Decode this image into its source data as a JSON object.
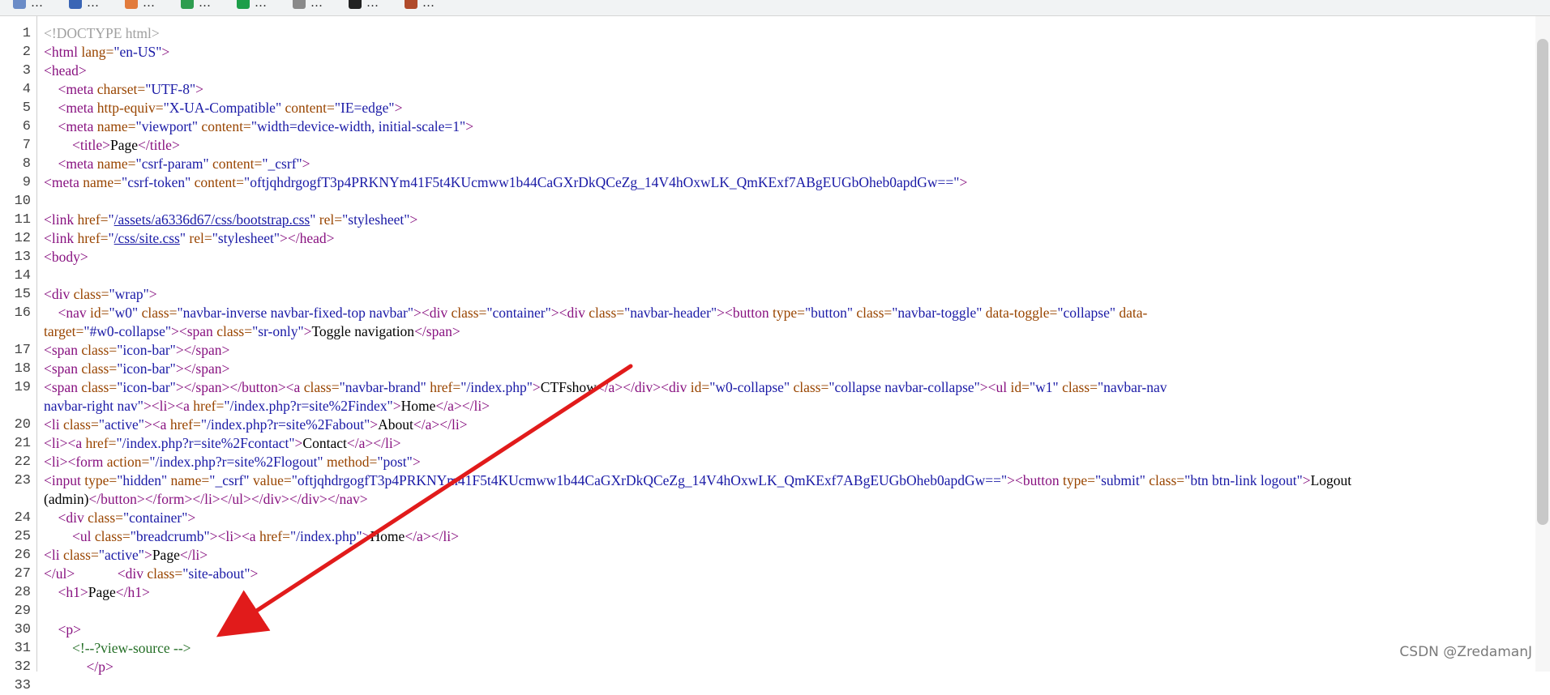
{
  "bookmarks": [
    {
      "label": "…"
    },
    {
      "label": "…"
    },
    {
      "label": "…"
    },
    {
      "label": "…"
    },
    {
      "label": "…"
    },
    {
      "label": "…"
    },
    {
      "label": "…"
    },
    {
      "label": "…"
    }
  ],
  "source": {
    "lines": [
      {
        "n": "1",
        "html": "<span class=\"d\">&lt;!DOCTYPE html&gt;</span>"
      },
      {
        "n": "2",
        "html": "<span class=\"t\">&lt;html</span> <span class=\"a\">lang=</span><span class=\"v\">\"en-US\"</span><span class=\"t\">&gt;</span>"
      },
      {
        "n": "3",
        "html": "<span class=\"t\">&lt;head&gt;</span>"
      },
      {
        "n": "4",
        "html": "    <span class=\"t\">&lt;meta</span> <span class=\"a\">charset=</span><span class=\"v\">\"UTF-8\"</span><span class=\"t\">&gt;</span>"
      },
      {
        "n": "5",
        "html": "    <span class=\"t\">&lt;meta</span> <span class=\"a\">http-equiv=</span><span class=\"v\">\"X-UA-Compatible\"</span> <span class=\"a\">content=</span><span class=\"v\">\"IE=edge\"</span><span class=\"t\">&gt;</span>"
      },
      {
        "n": "6",
        "html": "    <span class=\"t\">&lt;meta</span> <span class=\"a\">name=</span><span class=\"v\">\"viewport\"</span> <span class=\"a\">content=</span><span class=\"v\">\"width=device-width, initial-scale=1\"</span><span class=\"t\">&gt;</span>"
      },
      {
        "n": "7",
        "html": "        <span class=\"t\">&lt;title&gt;</span><span class=\"txt\">Page</span><span class=\"t\">&lt;/title&gt;</span>"
      },
      {
        "n": "8",
        "html": "    <span class=\"t\">&lt;meta</span> <span class=\"a\">name=</span><span class=\"v\">\"csrf-param\"</span> <span class=\"a\">content=</span><span class=\"v\">\"_csrf\"</span><span class=\"t\">&gt;</span>"
      },
      {
        "n": "9",
        "html": "<span class=\"t\">&lt;meta</span> <span class=\"a\">name=</span><span class=\"v\">\"csrf-token\"</span> <span class=\"a\">content=</span><span class=\"v\">\"oftjqhdrgogfT3p4PRKNYm41F5t4KUcmww1b44CaGXrDkQCeZg_14V4hOxwLK_QmKExf7ABgEUGbOheb0apdGw==\"</span><span class=\"t\">&gt;</span>"
      },
      {
        "n": "10",
        "html": ""
      },
      {
        "n": "11",
        "html": "<span class=\"t\">&lt;link</span> <span class=\"a\">href=</span><span class=\"v\">\"</span><span class=\"link\">/assets/a6336d67/css/bootstrap.css</span><span class=\"v\">\"</span> <span class=\"a\">rel=</span><span class=\"v\">\"stylesheet\"</span><span class=\"t\">&gt;</span>"
      },
      {
        "n": "12",
        "html": "<span class=\"t\">&lt;link</span> <span class=\"a\">href=</span><span class=\"v\">\"</span><span class=\"link\">/css/site.css</span><span class=\"v\">\"</span> <span class=\"a\">rel=</span><span class=\"v\">\"stylesheet\"</span><span class=\"t\">&gt;&lt;/head&gt;</span>"
      },
      {
        "n": "13",
        "html": "<span class=\"t\">&lt;body&gt;</span>"
      },
      {
        "n": "14",
        "html": ""
      },
      {
        "n": "15",
        "html": "<span class=\"t\">&lt;div</span> <span class=\"a\">class=</span><span class=\"v\">\"wrap\"</span><span class=\"t\">&gt;</span>"
      },
      {
        "n": "16",
        "html": "    <span class=\"t\">&lt;nav</span> <span class=\"a\">id=</span><span class=\"v\">\"w0\"</span> <span class=\"a\">class=</span><span class=\"v\">\"navbar-inverse navbar-fixed-top navbar\"</span><span class=\"t\">&gt;&lt;div</span> <span class=\"a\">class=</span><span class=\"v\">\"container\"</span><span class=\"t\">&gt;&lt;div</span> <span class=\"a\">class=</span><span class=\"v\">\"navbar-header\"</span><span class=\"t\">&gt;&lt;button</span> <span class=\"a\">type=</span><span class=\"v\">\"button\"</span> <span class=\"a\">class=</span><span class=\"v\">\"navbar-toggle\"</span> <span class=\"a\">data-toggle=</span><span class=\"v\">\"collapse\"</span> <span class=\"a\">data-</span>"
      },
      {
        "n": "",
        "html": "<span class=\"a\">target=</span><span class=\"v\">\"#w0-collapse\"</span><span class=\"t\">&gt;&lt;span</span> <span class=\"a\">class=</span><span class=\"v\">\"sr-only\"</span><span class=\"t\">&gt;</span><span class=\"txt\">Toggle navigation</span><span class=\"t\">&lt;/span&gt;</span>"
      },
      {
        "n": "17",
        "html": "<span class=\"t\">&lt;span</span> <span class=\"a\">class=</span><span class=\"v\">\"icon-bar\"</span><span class=\"t\">&gt;&lt;/span&gt;</span>"
      },
      {
        "n": "18",
        "html": "<span class=\"t\">&lt;span</span> <span class=\"a\">class=</span><span class=\"v\">\"icon-bar\"</span><span class=\"t\">&gt;&lt;/span&gt;</span>"
      },
      {
        "n": "19",
        "html": "<span class=\"t\">&lt;span</span> <span class=\"a\">class=</span><span class=\"v\">\"icon-bar\"</span><span class=\"t\">&gt;&lt;/span&gt;&lt;/button&gt;&lt;a</span> <span class=\"a\">class=</span><span class=\"v\">\"navbar-brand\"</span> <span class=\"a\">href=</span><span class=\"v\">\"/index.php\"</span><span class=\"t\">&gt;</span><span class=\"txt\">CTFshow</span><span class=\"t\">&lt;/a&gt;&lt;/div&gt;&lt;div</span> <span class=\"a\">id=</span><span class=\"v\">\"w0-collapse\"</span> <span class=\"a\">class=</span><span class=\"v\">\"collapse navbar-collapse\"</span><span class=\"t\">&gt;&lt;ul</span> <span class=\"a\">id=</span><span class=\"v\">\"w1\"</span> <span class=\"a\">class=</span><span class=\"v\">\"navbar-nav</span>"
      },
      {
        "n": "",
        "html": "<span class=\"v\">navbar-right nav\"</span><span class=\"t\">&gt;&lt;li&gt;&lt;a</span> <span class=\"a\">href=</span><span class=\"v\">\"/index.php?r=site%2Findex\"</span><span class=\"t\">&gt;</span><span class=\"txt\">Home</span><span class=\"t\">&lt;/a&gt;&lt;/li&gt;</span>"
      },
      {
        "n": "20",
        "html": "<span class=\"t\">&lt;li</span> <span class=\"a\">class=</span><span class=\"v\">\"active\"</span><span class=\"t\">&gt;&lt;a</span> <span class=\"a\">href=</span><span class=\"v\">\"/index.php?r=site%2Fabout\"</span><span class=\"t\">&gt;</span><span class=\"txt\">About</span><span class=\"t\">&lt;/a&gt;&lt;/li&gt;</span>"
      },
      {
        "n": "21",
        "html": "<span class=\"t\">&lt;li&gt;&lt;a</span> <span class=\"a\">href=</span><span class=\"v\">\"/index.php?r=site%2Fcontact\"</span><span class=\"t\">&gt;</span><span class=\"txt\">Contact</span><span class=\"t\">&lt;/a&gt;&lt;/li&gt;</span>"
      },
      {
        "n": "22",
        "html": "<span class=\"t\">&lt;li&gt;&lt;form</span> <span class=\"a\">action=</span><span class=\"v\">\"/index.php?r=site%2Flogout\"</span> <span class=\"a\">method=</span><span class=\"v\">\"post\"</span><span class=\"t\">&gt;</span>"
      },
      {
        "n": "23",
        "html": "<span class=\"t\">&lt;input</span> <span class=\"a\">type=</span><span class=\"v\">\"hidden\"</span> <span class=\"a\">name=</span><span class=\"v\">\"_csrf\"</span> <span class=\"a\">value=</span><span class=\"v\">\"oftjqhdrgogfT3p4PRKNYm41F5t4KUcmww1b44CaGXrDkQCeZg_14V4hOxwLK_QmKExf7ABgEUGbOheb0apdGw==\"</span><span class=\"t\">&gt;&lt;button</span> <span class=\"a\">type=</span><span class=\"v\">\"submit\"</span> <span class=\"a\">class=</span><span class=\"v\">\"btn btn-link logout\"</span><span class=\"t\">&gt;</span><span class=\"txt\">Logout</span>"
      },
      {
        "n": "",
        "html": "<span class=\"txt\">(admin)</span><span class=\"t\">&lt;/button&gt;&lt;/form&gt;&lt;/li&gt;&lt;/ul&gt;&lt;/div&gt;&lt;/div&gt;&lt;/nav&gt;</span>"
      },
      {
        "n": "24",
        "html": "    <span class=\"t\">&lt;div</span> <span class=\"a\">class=</span><span class=\"v\">\"container\"</span><span class=\"t\">&gt;</span>"
      },
      {
        "n": "25",
        "html": "        <span class=\"t\">&lt;ul</span> <span class=\"a\">class=</span><span class=\"v\">\"breadcrumb\"</span><span class=\"t\">&gt;&lt;li&gt;&lt;a</span> <span class=\"a\">href=</span><span class=\"v\">\"/index.php\"</span><span class=\"t\">&gt;</span><span class=\"txt\">Home</span><span class=\"t\">&lt;/a&gt;&lt;/li&gt;</span>"
      },
      {
        "n": "26",
        "html": "<span class=\"t\">&lt;li</span> <span class=\"a\">class=</span><span class=\"v\">\"active\"</span><span class=\"t\">&gt;</span><span class=\"txt\">Page</span><span class=\"t\">&lt;/li&gt;</span>"
      },
      {
        "n": "27",
        "html": "<span class=\"t\">&lt;/ul&gt;</span>            <span class=\"t\">&lt;div</span> <span class=\"a\">class=</span><span class=\"v\">\"site-about\"</span><span class=\"t\">&gt;</span>"
      },
      {
        "n": "28",
        "html": "    <span class=\"t\">&lt;h1&gt;</span><span class=\"txt\">Page</span><span class=\"t\">&lt;/h1&gt;</span>"
      },
      {
        "n": "29",
        "html": ""
      },
      {
        "n": "30",
        "html": "    <span class=\"t\">&lt;p&gt;</span>"
      },
      {
        "n": "31",
        "html": "        <span class=\"c\">&lt;!--?view-source --&gt;</span>"
      },
      {
        "n": "32",
        "html": "            <span class=\"t\">&lt;/p&gt;</span>"
      },
      {
        "n": "33",
        "html": ""
      }
    ]
  },
  "watermark": "CSDN @ZredamanJ",
  "colors": {
    "arrow": "#e11b1b"
  }
}
